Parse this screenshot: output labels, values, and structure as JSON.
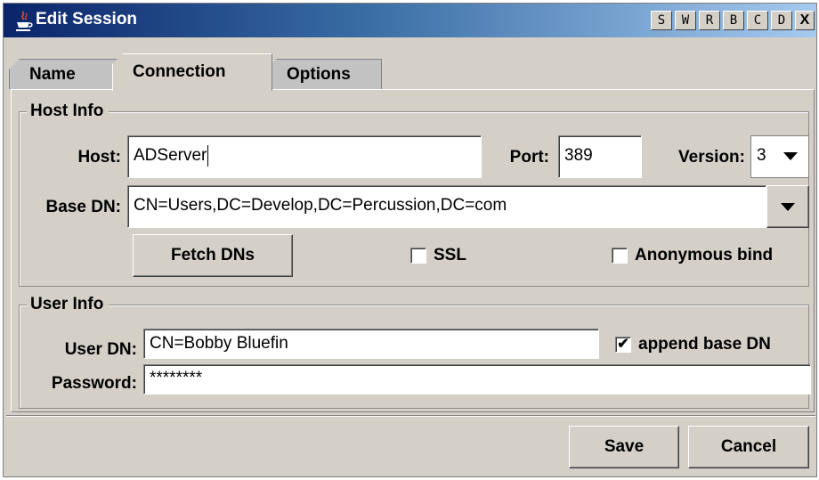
{
  "window": {
    "title": "Edit Session",
    "title_buttons": [
      "S",
      "W",
      "R",
      "B",
      "C",
      "D"
    ],
    "close_label": "X"
  },
  "tabs": [
    {
      "label": "Name",
      "active": false
    },
    {
      "label": "Connection",
      "active": true
    },
    {
      "label": "Options",
      "active": false
    }
  ],
  "host_info": {
    "title": "Host Info",
    "host_label": "Host:",
    "host_value": "ADServer",
    "port_label": "Port:",
    "port_value": "389",
    "version_label": "Version:",
    "version_value": "3",
    "base_dn_label": "Base DN:",
    "base_dn_value": "CN=Users,DC=Develop,DC=Percussion,DC=com",
    "fetch_button": "Fetch DNs",
    "ssl_label": "SSL",
    "ssl_checked": false,
    "anon_label": "Anonymous bind",
    "anon_checked": false
  },
  "user_info": {
    "title": "User Info",
    "user_dn_label": "User DN:",
    "user_dn_value": "CN=Bobby Bluefin",
    "append_label": "append base DN",
    "append_checked": true,
    "append_mark": "✔",
    "password_label": "Password:",
    "password_value": "********"
  },
  "footer": {
    "save_label": "Save",
    "cancel_label": "Cancel"
  },
  "colors": {
    "title_gradient_start": "#0a246a",
    "title_gradient_end": "#a6caf0",
    "face": "#d4d0c8"
  }
}
